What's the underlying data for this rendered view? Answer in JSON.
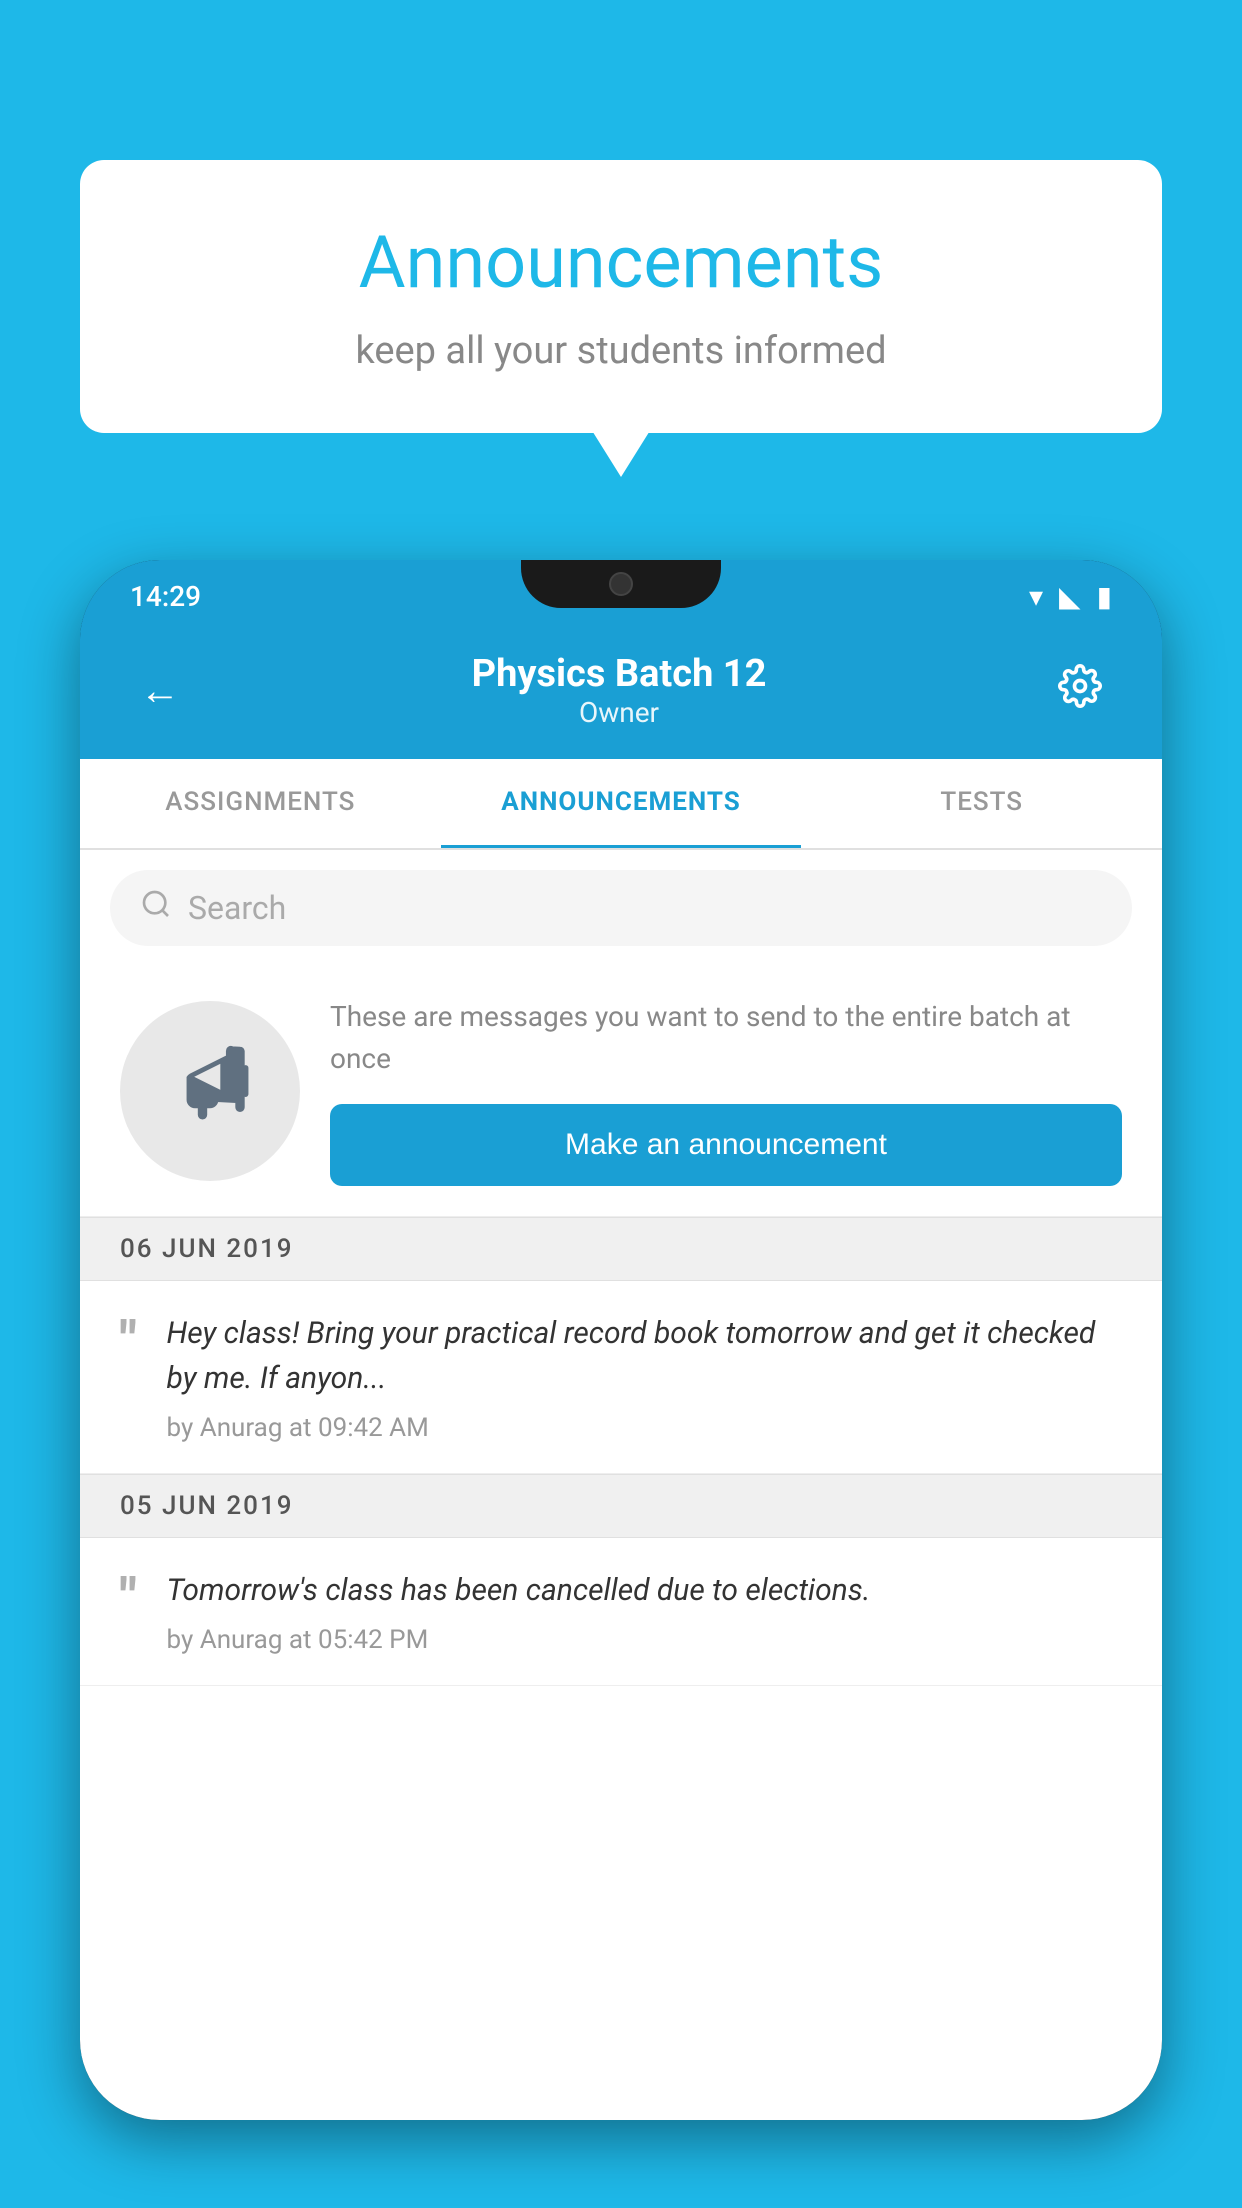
{
  "background_color": "#1eb8e8",
  "speech_bubble": {
    "title": "Announcements",
    "subtitle": "keep all your students informed"
  },
  "phone": {
    "status_bar": {
      "time": "14:29"
    },
    "header": {
      "back_label": "←",
      "title": "Physics Batch 12",
      "subtitle": "Owner",
      "settings_label": "⚙"
    },
    "tabs": [
      {
        "label": "ASSIGNMENTS",
        "active": false
      },
      {
        "label": "ANNOUNCEMENTS",
        "active": true
      },
      {
        "label": "TESTS",
        "active": false
      }
    ],
    "search": {
      "placeholder": "Search"
    },
    "announcement_prompt": {
      "icon_label": "📢",
      "description": "These are messages you want to send to the entire batch at once",
      "button_label": "Make an announcement"
    },
    "announcements": [
      {
        "date": "06  JUN  2019",
        "items": [
          {
            "text": "Hey class! Bring your practical record book tomorrow and get it checked by me. If anyon...",
            "meta": "by Anurag at 09:42 AM"
          }
        ]
      },
      {
        "date": "05  JUN  2019",
        "items": [
          {
            "text": "Tomorrow's class has been cancelled due to elections.",
            "meta": "by Anurag at 05:42 PM"
          }
        ]
      }
    ]
  }
}
